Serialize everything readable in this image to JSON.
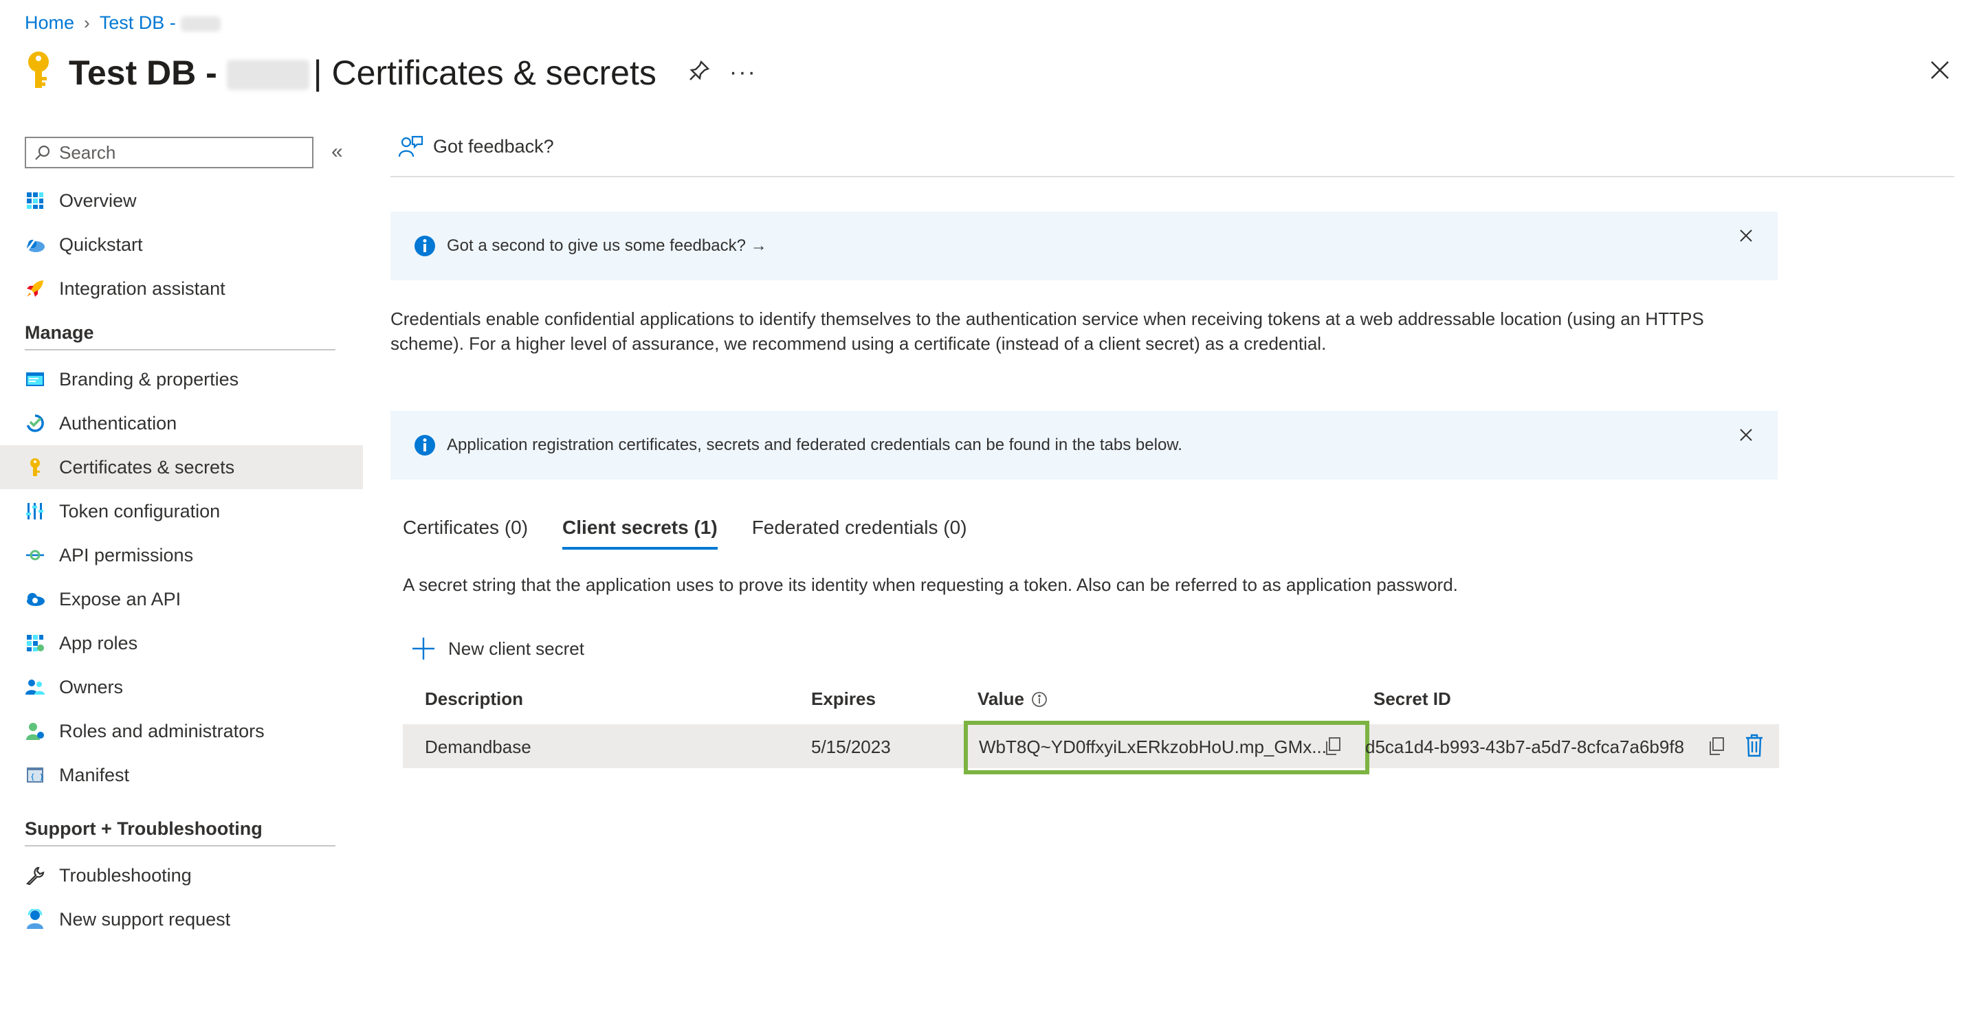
{
  "breadcrumb": {
    "home": "Home",
    "app": "Test DB - "
  },
  "header": {
    "title_prefix": "Test DB - ",
    "title_suffix": "| Certificates & secrets",
    "more": "···"
  },
  "sidebar": {
    "search_placeholder": "Search",
    "top_items": [
      {
        "label": "Overview",
        "icon": "overview-grid-icon"
      },
      {
        "label": "Quickstart",
        "icon": "quickstart-cloud-icon"
      },
      {
        "label": "Integration assistant",
        "icon": "rocket-icon"
      }
    ],
    "manage_header": "Manage",
    "manage_items": [
      {
        "label": "Branding & properties",
        "icon": "branding-icon"
      },
      {
        "label": "Authentication",
        "icon": "authentication-icon"
      },
      {
        "label": "Certificates & secrets",
        "icon": "key-icon",
        "selected": true
      },
      {
        "label": "Token configuration",
        "icon": "token-bars-icon"
      },
      {
        "label": "API permissions",
        "icon": "api-permissions-icon"
      },
      {
        "label": "Expose an API",
        "icon": "expose-api-cloud-icon"
      },
      {
        "label": "App roles",
        "icon": "app-roles-grid-icon"
      },
      {
        "label": "Owners",
        "icon": "owners-icon"
      },
      {
        "label": "Roles and administrators",
        "icon": "roles-admins-icon"
      },
      {
        "label": "Manifest",
        "icon": "manifest-icon"
      }
    ],
    "support_header": "Support + Troubleshooting",
    "support_items": [
      {
        "label": "Troubleshooting",
        "icon": "wrench-icon"
      },
      {
        "label": "New support request",
        "icon": "support-person-icon"
      }
    ]
  },
  "main": {
    "feedback_label": "Got feedback?",
    "banner1": "Got a second to give us some feedback? →",
    "description": "Credentials enable confidential applications to identify themselves to the authentication service when receiving tokens at a web addressable location (using an HTTPS scheme). For a higher level of assurance, we recommend using a certificate (instead of a client secret) as a credential.",
    "banner2": "Application registration certificates, secrets and federated credentials can be found in the tabs below.",
    "tabs": [
      {
        "label": "Certificates (0)"
      },
      {
        "label": "Client secrets (1)",
        "active": true
      },
      {
        "label": "Federated credentials (0)"
      }
    ],
    "tab_description": "A secret string that the application uses to prove its identity when requesting a token. Also can be referred to as application password.",
    "new_secret_label": "New client secret",
    "table": {
      "headers": [
        "Description",
        "Expires",
        "Value",
        "Secret ID"
      ],
      "rows": [
        {
          "description": "Demandbase",
          "expires": "5/15/2023",
          "value": "WbT8Q~YD0ffxyiLxERkzobHoU.mp_GMx...",
          "secret_id": "d5ca1d4-b993-43b7-a5d7-8cfca7a6b9f8"
        }
      ]
    }
  },
  "colors": {
    "accent": "#0078d4",
    "highlight": "#7cb342",
    "banner_bg": "#eff6fc",
    "selected_bg": "#edebe9"
  }
}
